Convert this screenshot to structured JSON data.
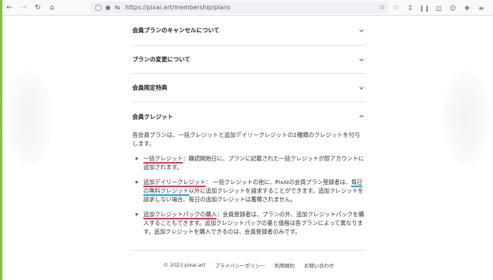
{
  "browser": {
    "url": "https://pixai.art/membership/plans"
  },
  "accordion": {
    "items": [
      {
        "title": "会員プランのキャンセルについて"
      },
      {
        "title": "プランの変更について"
      },
      {
        "title": "会員限定特典"
      }
    ],
    "open": {
      "title": "会員クレジット",
      "intro": "各会員プランは、一括クレジットと追加デイリークレジットの2種類のクレジットを付与します。",
      "bullets": [
        {
          "term": "一括クレジット",
          "text": "：購読開始日に、プランに記載された一括クレジットが即アカウントに追加されます。"
        },
        {
          "term": "追加デイリークレジット",
          "text_a": "： 一括クレジットの他に、PixAIの会員プラン登録者は、",
          "emph": "毎日の無料クレジット",
          "text_b": "以外に追加クレジットを請求することができます。追加クレジットを請求しない場合、毎日の追加クレジットは蓄積されません。"
        },
        {
          "term": "追加クレジットパックの購入",
          "text": "：会員登録者は、プランの外、追加クレジットパックを購入することもできます。追加クレジットパックの量と価格は各プランによって異なります。追加クレジットを購入できるのは、会員登録者のみです。"
        }
      ]
    }
  },
  "footer": {
    "copyright": "© 2023 pixai.art",
    "privacy": "プライバシーポリシー",
    "terms": "利用規約",
    "contact": "お問い合わせ"
  },
  "colors": {
    "red_underline": "#e8344e",
    "blue_underline": "#22a6e6",
    "green_edge": "#86c33a"
  }
}
